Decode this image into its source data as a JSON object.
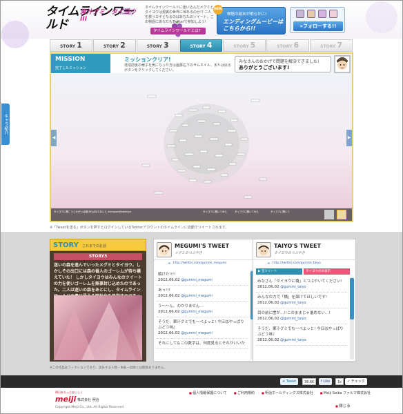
{
  "header": {
    "logo_main": "タイムラインワールド",
    "logo_sub": "果汁グミ・タイヨウ III",
    "logo_sub2": "Tweet Fantasy",
    "intro": "タイムラインワールドに迷い込んだメグミとタイヨウは現実の世界に帰れるのか!? 二人を救うカギとなるのはあなたのツイート。この物語にあなたもTwitterで参加しよう!",
    "intro_button": "タイムラインワールドとは?",
    "ending_new": "NEW",
    "ending_sub": "物語の結末が明らかに!",
    "ending_main": "エンディングムービーはこちらから!!",
    "follow_button": "»フォローする!!"
  },
  "tabs": [
    {
      "label": "STORY",
      "num": "1",
      "state": "done"
    },
    {
      "label": "STORY",
      "num": "2",
      "state": "done"
    },
    {
      "label": "STORY",
      "num": "3",
      "state": "done"
    },
    {
      "label": "STORY",
      "num": "4",
      "state": "active"
    },
    {
      "label": "STORY",
      "num": "5",
      "state": "locked"
    },
    {
      "label": "STORY",
      "num": "6",
      "state": "locked"
    },
    {
      "label": "STORY",
      "num": "7",
      "state": "locked"
    }
  ],
  "mission": {
    "title": "MISSION",
    "subtitle": "完了したミッション",
    "clear": "ミッションクリア!",
    "desc": "達成前後の様子を気になった方は画像右下のサムネイル、または戻るボタンをクリックしてください。",
    "speech_line1": "みなさんのおかげで問題を解決できました!",
    "speech_line2": "ありがとうございます!"
  },
  "thumbbar": [
    "タイヨウに聞こうとかがっぱ遅ければならないと #megumiifototaiyo",
    "タイヨウに聞いてみた",
    "タイヨウに聞いてみた",
    "タイヨウに聞いて"
  ],
  "side_tab": "キャラ紹介",
  "note": "※「Tweetを送る」ボタンを押すとログインしているTwitterアカウントのタイムラインに自動でツイートされます。",
  "story": {
    "head": "STORY",
    "head_sub": "これまでのお話",
    "chapter": "STORY3",
    "text": "迷いの森を進んでいったメグミとタイヨウ。しかしその出口には森の番人のゴーレムが待ち構えていた！ しかしタイヨウはみんなのツイートの力を使いゴーレムを無事封じ込めたのであった。二人は迷いの森をあとにし、タイムラインワールドの奥に見える時計台を目指すのであった。"
  },
  "megumi": {
    "name": "MEGUMI'S TWEET",
    "ja": "メグミのつぶやき",
    "url": "http://twitter.com/gummi_megumi",
    "tweets": [
      {
        "text": "解けた!!!!",
        "date": "2012.06.02",
        "user": "@gummi_megumi"
      },
      {
        "text": "あっ!!!",
        "date": "2012.06.02",
        "user": "@gummi_megumi"
      },
      {
        "text": "う〜〜ん、わかりません…",
        "date": "2012.06.02",
        "user": "@gummi_megumi"
      },
      {
        "text": "そうだ、果汁グミでも一べよっと! 今日はやっぱりぶどう味♪",
        "date": "2012.06.02",
        "user": "@gummi_megumi"
      },
      {
        "text": "それにしてもこの数字は、何度見るとそれがいいか",
        "date": "",
        "user": ""
      }
    ]
  },
  "taiyo": {
    "name": "TAIYO'S TWEET",
    "ja": "タイヨウのつぶやき",
    "url": "http://twitter.com/gummi_taiyo",
    "tab1": "▶ 宝ツイート",
    "tab2": "タイヨウのみ表示",
    "tweets": [
      {
        "text": "みなさん「タイヨウに橋」とつぶやいてください!",
        "date": "2012.06.02",
        "user": "@gummi_taiyo"
      },
      {
        "text": "みんなの力で「橋」を架けてほしいです!",
        "date": "2012.06.02",
        "user": "@gummi_taiyo"
      },
      {
        "text": "目の前に崖が…!!このままじゃ進めない…!",
        "date": "2012.06.02",
        "user": "@gummi_taiyo"
      },
      {
        "text": "そうだ、果汁グミでも一べよっと! 今日はやっぱりぶどう味♪",
        "date": "2012.06.02",
        "user": "@gummi_taiyo"
      }
    ]
  },
  "disclaimer": "※この作品はフィクションであり、実在する人物・地名・団体とは関係ありません。",
  "social": {
    "tweet": "Tweet",
    "tweet_count": "38.6K",
    "like": "Like",
    "like_count": "1k",
    "check": "チェック"
  },
  "footer": {
    "tagline": "明日をもっとおいしく",
    "brand": "meiji",
    "company": "株式会社 明治",
    "copyright": "Copyright Meiji Co., Ltd. All Rights Reserved.",
    "links": [
      "個人情報保護について",
      "ご利用規約",
      "明治ホールディングス株式会社",
      "Meiji Seika ファルマ株式会社"
    ],
    "close": "閉じる"
  },
  "colors": {
    "accent": "#2e8fb0",
    "gold": "#f5ca3e",
    "meiji_red": "#c8102e"
  }
}
